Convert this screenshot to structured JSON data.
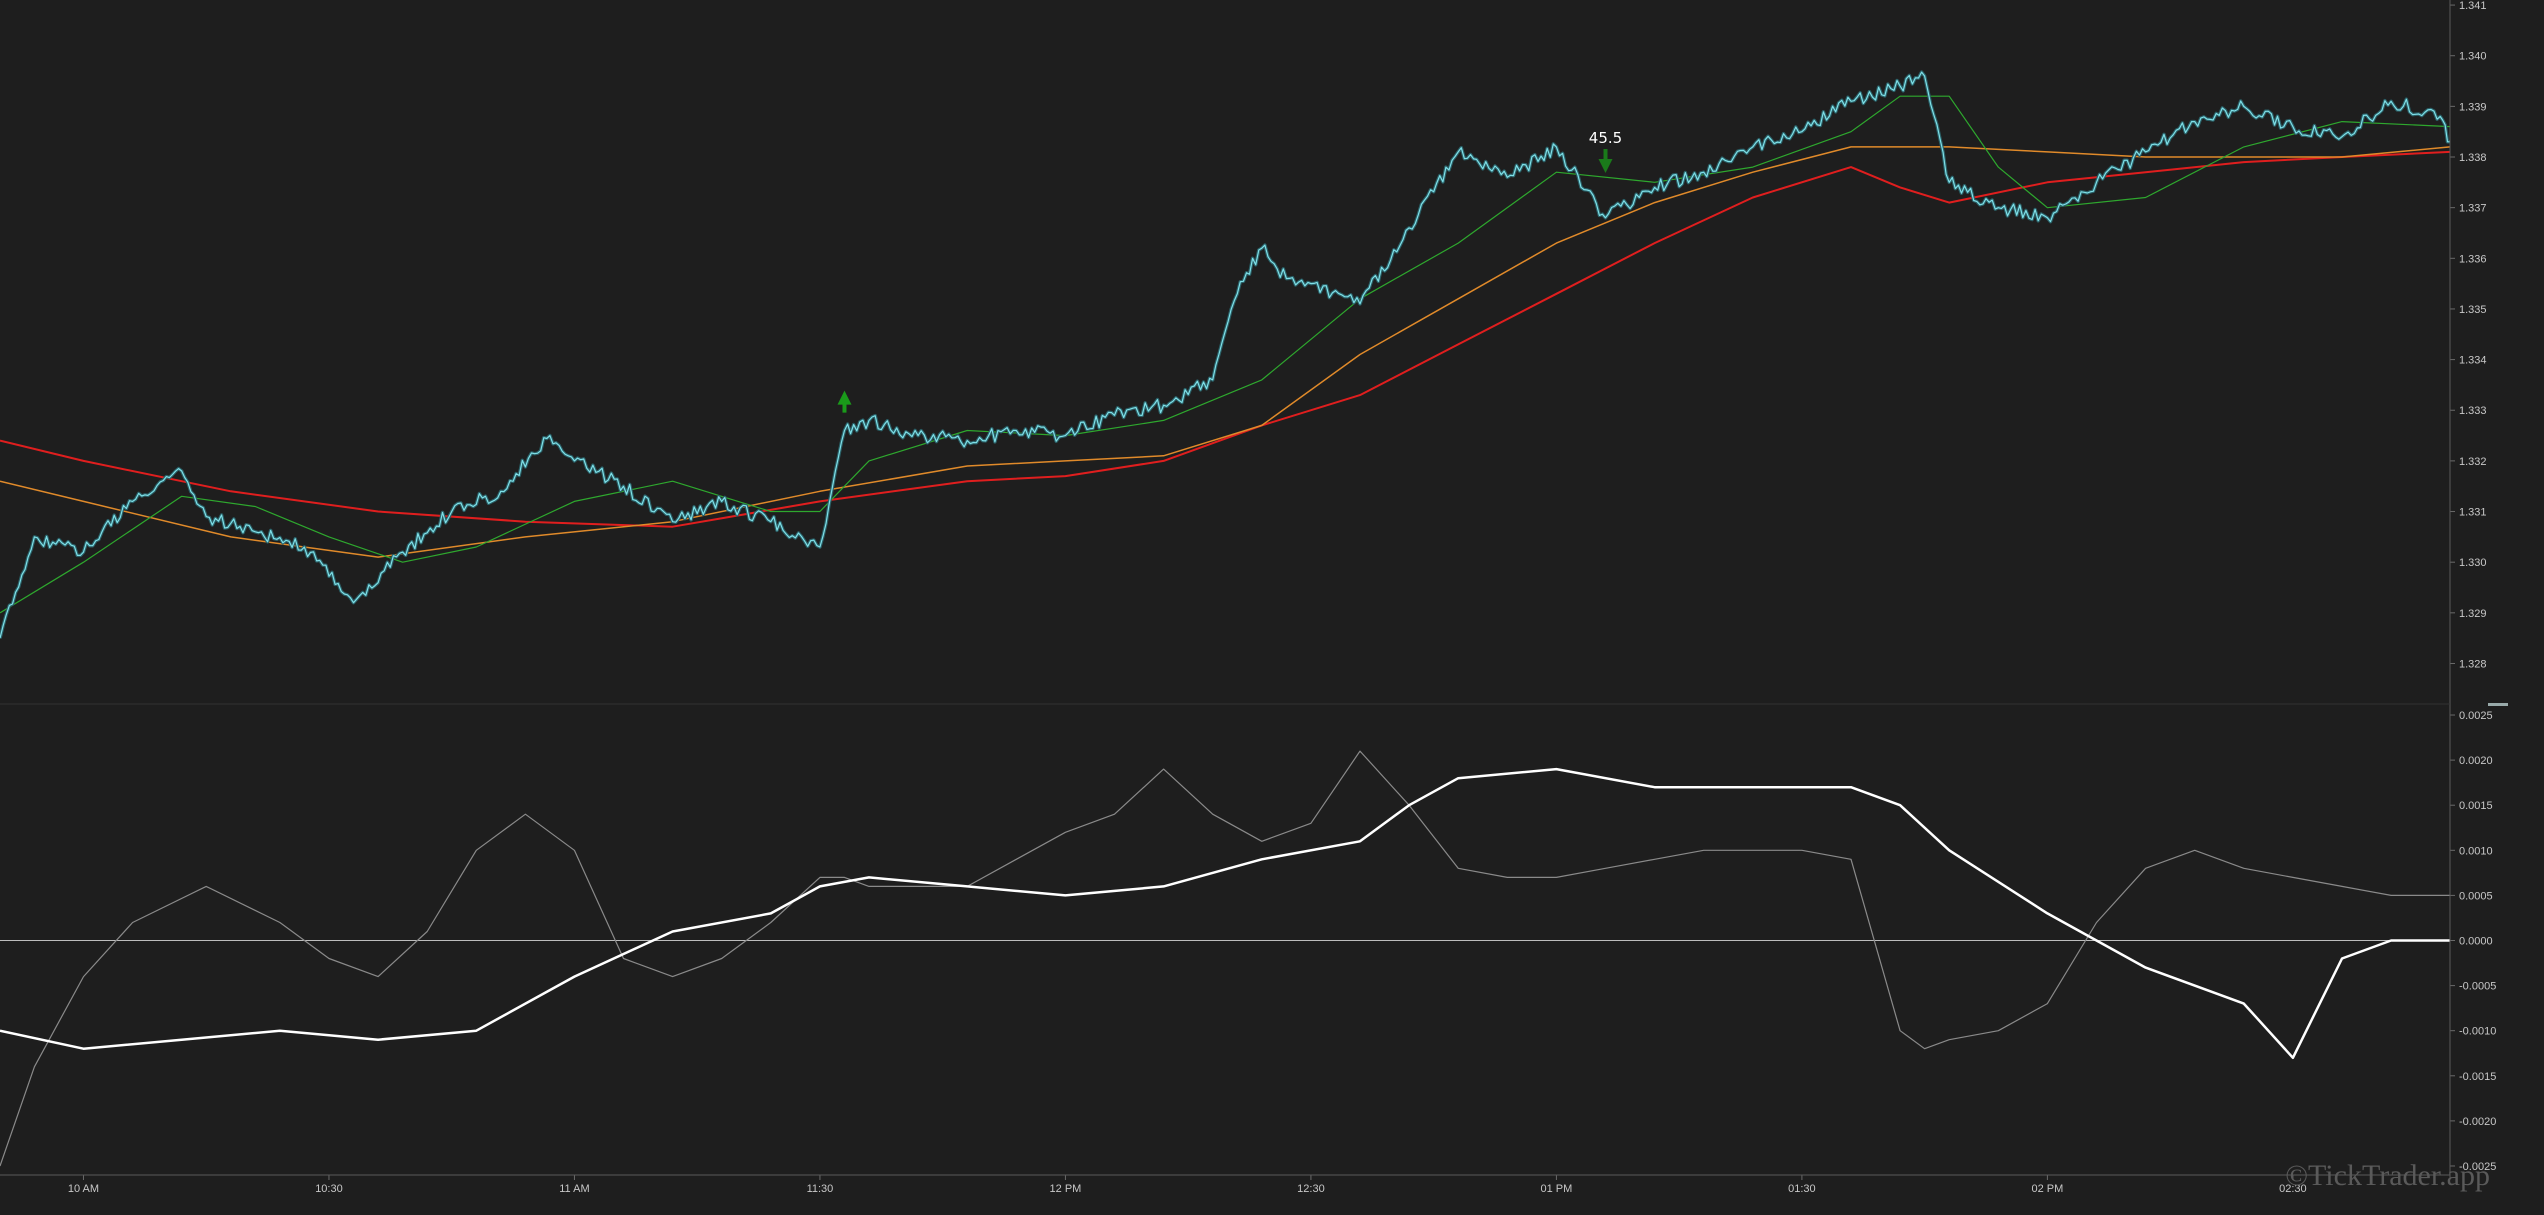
{
  "watermark": "©TickTrader.app",
  "colors": {
    "background": "#1e1e1e",
    "price": "#7fe0e8",
    "price_dark": "#2a5f66",
    "ma_fast": "#2ea82e",
    "ma_mid": "#e08a2a",
    "ma_slow": "#e01e1e",
    "osc_fast": "#8a8a8a",
    "osc_slow": "#ffffff",
    "zero_line": "#bdbdbd",
    "axis": "#6a6a6a",
    "marker_up": "#1a9a1a",
    "marker_down": "#1a7a1a"
  },
  "chart_data": [
    {
      "type": "line",
      "panel": "price",
      "yticks": [
        "1.328",
        "1.329",
        "1.330",
        "1.331",
        "1.332",
        "1.333",
        "1.334",
        "1.335",
        "1.336",
        "1.337",
        "1.338",
        "1.339",
        "1.340",
        "1.341"
      ],
      "ylim": [
        1.3272,
        1.3411
      ],
      "x_domain": [
        -0.17,
        4.82
      ],
      "xticks": [
        "10 AM",
        "10:30",
        "11 AM",
        "11:30",
        "12 PM",
        "12:30",
        "01 PM",
        "01:30",
        "02 PM",
        "02:30"
      ],
      "series": [
        {
          "key": "price",
          "x": [
            -0.17,
            -0.1,
            0.0,
            0.1,
            0.2,
            0.25,
            0.35,
            0.45,
            0.55,
            0.65,
            0.75,
            0.85,
            0.95,
            1.0,
            1.1,
            1.2,
            1.3,
            1.4,
            1.5,
            1.55,
            1.6,
            1.7,
            1.8,
            1.9,
            2.0,
            2.1,
            2.2,
            2.3,
            2.35,
            2.4,
            2.45,
            2.5,
            2.6,
            2.7,
            2.8,
            2.9,
            3.0,
            3.1,
            3.2,
            3.3,
            3.4,
            3.5,
            3.6,
            3.7,
            3.75,
            3.8,
            3.9,
            4.0,
            4.1,
            4.2,
            4.3,
            4.4,
            4.5,
            4.6,
            4.7,
            4.8,
            4.82
          ],
          "y": [
            1.3285,
            1.3305,
            1.3302,
            1.3312,
            1.3318,
            1.3309,
            1.3306,
            1.3303,
            1.3292,
            1.3302,
            1.331,
            1.3314,
            1.3325,
            1.332,
            1.3315,
            1.3308,
            1.3312,
            1.3308,
            1.3303,
            1.3326,
            1.3328,
            1.3325,
            1.3324,
            1.3326,
            1.3325,
            1.3329,
            1.3331,
            1.3336,
            1.3353,
            1.3362,
            1.3356,
            1.3355,
            1.3351,
            1.3366,
            1.3381,
            1.3376,
            1.3382,
            1.3368,
            1.3374,
            1.3377,
            1.3382,
            1.3385,
            1.3391,
            1.3394,
            1.3396,
            1.3375,
            1.337,
            1.3368,
            1.3375,
            1.3381,
            1.3387,
            1.339,
            1.3386,
            1.3384,
            1.3391,
            1.3388,
            1.3383
          ]
        },
        {
          "key": "ma_fast",
          "x": [
            -0.17,
            0.0,
            0.2,
            0.35,
            0.5,
            0.65,
            0.8,
            1.0,
            1.2,
            1.4,
            1.5,
            1.6,
            1.8,
            2.0,
            2.2,
            2.4,
            2.6,
            2.8,
            3.0,
            3.2,
            3.4,
            3.6,
            3.7,
            3.8,
            3.9,
            4.0,
            4.2,
            4.4,
            4.6,
            4.82
          ],
          "y": [
            1.329,
            1.33,
            1.3313,
            1.3311,
            1.3305,
            1.33,
            1.3303,
            1.3312,
            1.3316,
            1.331,
            1.331,
            1.332,
            1.3326,
            1.3325,
            1.3328,
            1.3336,
            1.3352,
            1.3363,
            1.3377,
            1.3375,
            1.3378,
            1.3385,
            1.3392,
            1.3392,
            1.3378,
            1.337,
            1.3372,
            1.3382,
            1.3387,
            1.3386
          ]
        },
        {
          "key": "ma_mid",
          "x": [
            -0.17,
            0.0,
            0.3,
            0.6,
            0.9,
            1.2,
            1.5,
            1.8,
            2.0,
            2.2,
            2.4,
            2.6,
            2.8,
            3.0,
            3.2,
            3.4,
            3.6,
            3.7,
            3.8,
            4.0,
            4.2,
            4.4,
            4.6,
            4.82
          ],
          "y": [
            1.3316,
            1.3312,
            1.3305,
            1.3301,
            1.3305,
            1.3308,
            1.3314,
            1.3319,
            1.332,
            1.3321,
            1.3327,
            1.3341,
            1.3352,
            1.3363,
            1.3371,
            1.3377,
            1.3382,
            1.3382,
            1.3382,
            1.3381,
            1.338,
            1.338,
            1.338,
            1.3382
          ]
        },
        {
          "key": "ma_slow",
          "x": [
            -0.17,
            0.0,
            0.3,
            0.6,
            0.9,
            1.2,
            1.5,
            1.8,
            2.0,
            2.2,
            2.4,
            2.6,
            2.8,
            3.0,
            3.2,
            3.4,
            3.6,
            3.7,
            3.8,
            4.0,
            4.2,
            4.4,
            4.6,
            4.82
          ],
          "y": [
            1.3324,
            1.332,
            1.3314,
            1.331,
            1.3308,
            1.3307,
            1.3312,
            1.3316,
            1.3317,
            1.332,
            1.3327,
            1.3333,
            1.3343,
            1.3353,
            1.3363,
            1.3372,
            1.3378,
            1.3374,
            1.3371,
            1.3375,
            1.3377,
            1.3379,
            1.338,
            1.3381
          ]
        }
      ],
      "markers": [
        {
          "type": "up",
          "x": 1.55,
          "y": 1.33315
        },
        {
          "type": "down",
          "x": 3.1,
          "y": 1.33792,
          "label": "45.5"
        }
      ]
    },
    {
      "type": "line",
      "panel": "oscillator",
      "yticks": [
        "-0.0025",
        "-0.0020",
        "-0.0015",
        "-0.0010",
        "-0.0005",
        "0.0000",
        "0.0005",
        "0.0010",
        "0.0015",
        "0.0020",
        "0.0025"
      ],
      "ylim": [
        -0.0026,
        0.0026
      ],
      "x_domain": [
        -0.17,
        4.82
      ],
      "series": [
        {
          "key": "osc_fast",
          "x": [
            -0.17,
            -0.1,
            0.0,
            0.1,
            0.25,
            0.4,
            0.5,
            0.6,
            0.7,
            0.8,
            0.9,
            1.0,
            1.1,
            1.2,
            1.3,
            1.4,
            1.5,
            1.55,
            1.6,
            1.7,
            1.8,
            1.9,
            2.0,
            2.1,
            2.2,
            2.3,
            2.4,
            2.5,
            2.6,
            2.7,
            2.8,
            2.9,
            3.0,
            3.1,
            3.2,
            3.3,
            3.4,
            3.5,
            3.6,
            3.7,
            3.75,
            3.8,
            3.9,
            4.0,
            4.1,
            4.2,
            4.3,
            4.4,
            4.5,
            4.6,
            4.7,
            4.82
          ],
          "y": [
            -0.0025,
            -0.0014,
            -0.0004,
            0.0002,
            0.0006,
            0.0002,
            -0.0002,
            -0.0004,
            0.0001,
            0.001,
            0.0014,
            0.001,
            -0.0002,
            -0.0004,
            -0.0002,
            0.0002,
            0.0007,
            0.0007,
            0.0006,
            0.0006,
            0.0006,
            0.0009,
            0.0012,
            0.0014,
            0.0019,
            0.0014,
            0.0011,
            0.0013,
            0.0021,
            0.0015,
            0.0008,
            0.0007,
            0.0007,
            0.0008,
            0.0009,
            0.001,
            0.001,
            0.001,
            0.0009,
            -0.001,
            -0.0012,
            -0.0011,
            -0.001,
            -0.0007,
            0.0002,
            0.0008,
            0.001,
            0.0008,
            0.0007,
            0.0006,
            0.0005,
            0.0005
          ]
        },
        {
          "key": "osc_slow",
          "x": [
            -0.17,
            0.0,
            0.2,
            0.4,
            0.6,
            0.8,
            1.0,
            1.2,
            1.4,
            1.5,
            1.6,
            1.8,
            2.0,
            2.2,
            2.4,
            2.6,
            2.7,
            2.8,
            3.0,
            3.2,
            3.4,
            3.6,
            3.7,
            3.8,
            4.0,
            4.2,
            4.4,
            4.5,
            4.6,
            4.7,
            4.82
          ],
          "y": [
            -0.001,
            -0.0012,
            -0.0011,
            -0.001,
            -0.0011,
            -0.001,
            -0.0004,
            0.0001,
            0.0003,
            0.0006,
            0.0007,
            0.0006,
            0.0005,
            0.0006,
            0.0009,
            0.0011,
            0.0015,
            0.0018,
            0.0019,
            0.0017,
            0.0017,
            0.0017,
            0.0015,
            0.001,
            0.0003,
            -0.0003,
            -0.0007,
            -0.0013,
            -0.0002,
            0.0,
            0.0
          ]
        }
      ]
    }
  ]
}
